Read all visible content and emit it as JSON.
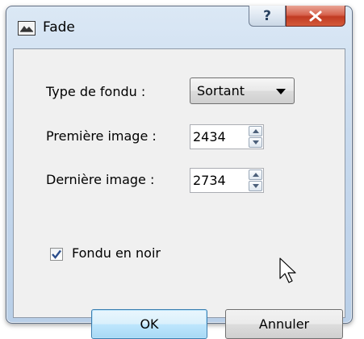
{
  "window": {
    "title": "Fade",
    "help_glyph": "?",
    "close_glyph": "X"
  },
  "form": {
    "fade_type": {
      "label": "Type de fondu :",
      "selected": "Sortant"
    },
    "first_image": {
      "label": "Première image :",
      "value": "2434"
    },
    "last_image": {
      "label": "Dernière image :",
      "value": "2734"
    },
    "fade_to_black": {
      "label": "Fondu en noir",
      "checked": true
    }
  },
  "buttons": {
    "ok_label": "OK",
    "cancel_label": "Annuler"
  },
  "icons": {
    "app": "fade-app-icon",
    "help": "help-icon",
    "close": "close-icon",
    "dropdown": "chevron-down-icon",
    "spin_up": "spin-up-icon",
    "spin_down": "spin-down-icon",
    "check": "checkmark-icon",
    "cursor": "mouse-pointer-icon"
  },
  "colors": {
    "titlebar": "#c8daee",
    "close_button": "#c13b22",
    "default_button_border": "#3c7fb1",
    "client_bg": "#f0f0f0"
  }
}
